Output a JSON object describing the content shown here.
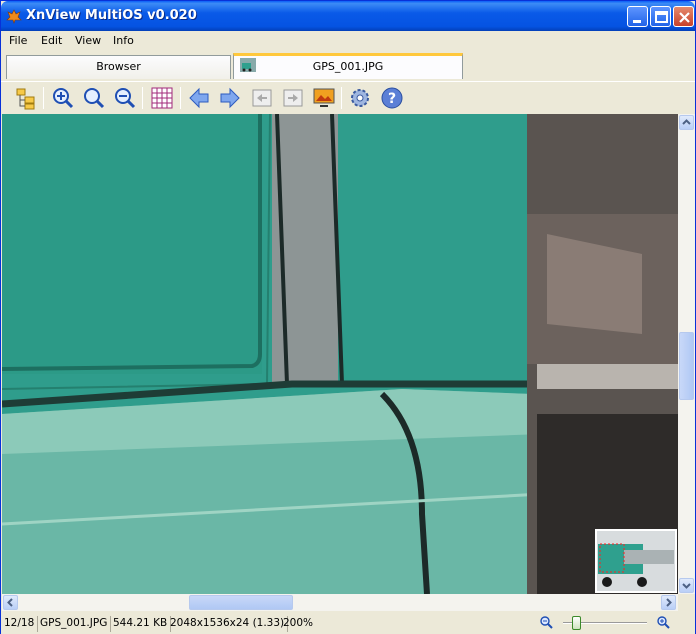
{
  "window": {
    "title": "XnView MultiOS v0.020"
  },
  "menu": {
    "items": [
      "File",
      "Edit",
      "View",
      "Info"
    ]
  },
  "tabs": {
    "browser": "Browser",
    "image": "GPS_001.JPG"
  },
  "toolbar": {
    "icons": [
      "folder-tree-icon",
      "zoom-fit-icon",
      "zoom-actual-icon",
      "zoom-out-icon",
      "grid-icon",
      "prev-arrow-icon",
      "next-arrow-icon",
      "first-page-icon",
      "last-page-icon",
      "slideshow-icon",
      "settings-gear-icon",
      "help-icon"
    ]
  },
  "status": {
    "position": "12/18",
    "filename": "GPS_001.JPG",
    "filesize": "544.21 KB",
    "dimensions": "2048x1536x24 (1.33)",
    "zoom": "200%"
  },
  "zoom_slider": {
    "level": 0.15
  },
  "colors": {
    "accent_tab": "#ffc83c",
    "titlebar": "#0553e2",
    "truck": "#2fa08e"
  }
}
